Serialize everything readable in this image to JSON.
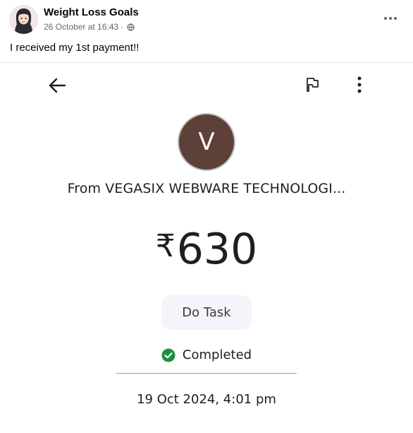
{
  "post": {
    "author": "Weight Loss Goals",
    "timestamp": "26 October at 16:43",
    "separator_dot": "·",
    "privacy_icon": "globe-icon",
    "more_icon": "more-options-icon",
    "text": "I received my 1st payment!!"
  },
  "payment": {
    "toolbar": {
      "back_icon": "arrow-left-icon",
      "flag_icon": "flag-icon",
      "menu_icon": "kebab-menu-icon"
    },
    "payer_initial": "V",
    "payer_label": "From VEGASIX WEBWARE TECHNOLOGI...",
    "currency_symbol": "₹",
    "amount": "630",
    "note": "Do Task",
    "status": "Completed",
    "status_color": "#1e8e3e",
    "avatar_color": "#5d4037",
    "date": "19 Oct 2024, 4:01 pm"
  }
}
